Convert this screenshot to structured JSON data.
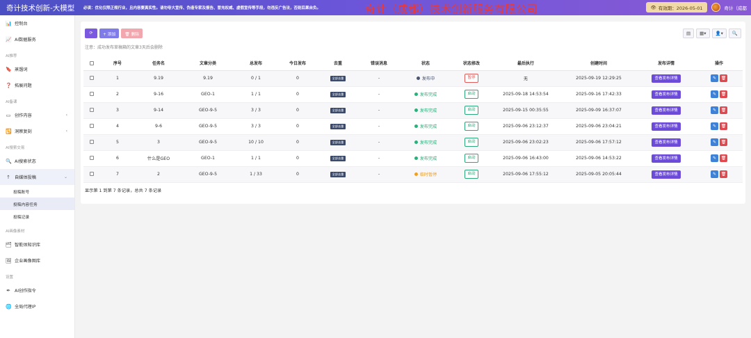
{
  "header": {
    "brand": "奇计技术创新-大模型",
    "notice": "必读：优化仅限正规行业，且内容要真实性。请勿夸大宣传、伪造专家及报告、冒充权威、虚假宣传等手段，勿违反广告法，否则后果自负。",
    "company_banner": "奇计（成都）技术创新服务有限公司",
    "expire_label": "有效期：2026-05-01",
    "username": "奇计（成都"
  },
  "sidebar": {
    "items": [
      {
        "type": "item",
        "icon": "📊",
        "label": "控制台"
      },
      {
        "type": "item",
        "icon": "📈",
        "label": "AI数据服务"
      },
      {
        "type": "group",
        "label": "AI推荐"
      },
      {
        "type": "item",
        "icon": "🔖",
        "label": "蒸馏词"
      },
      {
        "type": "item",
        "icon": "❓",
        "label": "拓展问题"
      },
      {
        "type": "group",
        "label": "AI备课"
      },
      {
        "type": "item",
        "icon": "▭",
        "label": "创作内容",
        "chevron": "‹"
      },
      {
        "type": "item",
        "icon": "🔁",
        "label": "洞察复刻",
        "chevron": "‹"
      },
      {
        "type": "group",
        "label": "AI搜索交易"
      },
      {
        "type": "item",
        "icon": "🔍",
        "label": "AI搜索状态"
      },
      {
        "type": "item",
        "icon": "↑",
        "label": "自媒体投稿",
        "chevron": "⌄",
        "active_parent": true
      },
      {
        "type": "sub",
        "label": "投稿账号"
      },
      {
        "type": "sub",
        "label": "投稿内容任务",
        "active": true
      },
      {
        "type": "sub",
        "label": "投稿记录"
      },
      {
        "type": "group",
        "label": "AI画像素材"
      },
      {
        "type": "item",
        "icon": "🗂",
        "label": "智能体知识库"
      },
      {
        "type": "item",
        "icon": "🖼",
        "label": "企业画像图库"
      },
      {
        "type": "group",
        "label": "设置"
      },
      {
        "type": "item",
        "icon": "✒",
        "label": "AI创作指令"
      },
      {
        "type": "item",
        "icon": "🌐",
        "label": "全局代理IP"
      }
    ]
  },
  "toolbar": {
    "refresh_icon": "⟳",
    "add_label": "+ 添加",
    "delete_label": "🗑 删除",
    "view_buttons": [
      "▤",
      "▦▾",
      "👤▾",
      "🔍"
    ]
  },
  "hint": "注意：成功发布草稿箱的文章3天后会删除",
  "table": {
    "columns": [
      "",
      "序号",
      "任务名",
      "文章分类",
      "总发布",
      "今日发布",
      "去重",
      "错误消息",
      "状态",
      "状态修改",
      "最后执行",
      "创建时间",
      "发布详情",
      "操作"
    ],
    "rows": [
      {
        "no": "1",
        "name": "9.19",
        "category": "9.19",
        "total": "0 / 1",
        "today": "0",
        "dedup": "全部去重",
        "error": "-",
        "status": "发布中",
        "status_color": "#4a5570",
        "action": "暂停",
        "action_kind": "pause",
        "last": "无",
        "created": "2025-09-19 12:29:25",
        "detail": "查看发布详情"
      },
      {
        "no": "2",
        "name": "9-16",
        "category": "GEO-1",
        "total": "1 / 1",
        "today": "0",
        "dedup": "全部去重",
        "error": "-",
        "status": "发布完成",
        "status_color": "#2ab07a",
        "action": "启动",
        "action_kind": "start",
        "last": "2025-09-18 14:53:54",
        "created": "2025-09-16 17:42:33",
        "detail": "查看发布详情"
      },
      {
        "no": "3",
        "name": "9-14",
        "category": "GEO-9-5",
        "total": "3 / 3",
        "today": "0",
        "dedup": "全部去重",
        "error": "-",
        "status": "发布完成",
        "status_color": "#2ab07a",
        "action": "启动",
        "action_kind": "start",
        "last": "2025-09-15 00:35:55",
        "created": "2025-09-09 16:37:07",
        "detail": "查看发布详情"
      },
      {
        "no": "4",
        "name": "9-6",
        "category": "GEO-9-5",
        "total": "3 / 3",
        "today": "0",
        "dedup": "全部去重",
        "error": "-",
        "status": "发布完成",
        "status_color": "#2ab07a",
        "action": "启动",
        "action_kind": "start",
        "last": "2025-09-06 23:12:37",
        "created": "2025-09-06 23:04:21",
        "detail": "查看发布详情"
      },
      {
        "no": "5",
        "name": "3",
        "category": "GEO-9-5",
        "total": "10 / 10",
        "today": "0",
        "dedup": "全部去重",
        "error": "-",
        "status": "发布完成",
        "status_color": "#2ab07a",
        "action": "启动",
        "action_kind": "start",
        "last": "2025-09-06 23:02:23",
        "created": "2025-09-06 17:57:12",
        "detail": "查看发布详情"
      },
      {
        "no": "6",
        "name": "什么是GEO",
        "category": "GEO-1",
        "total": "1 / 1",
        "today": "0",
        "dedup": "全部去重",
        "error": "-",
        "status": "发布完成",
        "status_color": "#2ab07a",
        "action": "启动",
        "action_kind": "start",
        "last": "2025-09-06 16:43:00",
        "created": "2025-09-06 14:53:22",
        "detail": "查看发布详情"
      },
      {
        "no": "7",
        "name": "2",
        "category": "GEO-9-5",
        "total": "1 / 33",
        "today": "0",
        "dedup": "全部去重",
        "error": "-",
        "status": "临时暂停",
        "status_color": "#f0a020",
        "action": "启动",
        "action_kind": "start",
        "last": "2025-09-06 17:55:12",
        "created": "2025-09-05 20:05:44",
        "detail": "查看发布详情"
      }
    ],
    "edit_icon": "✎",
    "delete_icon": "🗑"
  },
  "pagination_text": "显示第 1 到第 7 条记录，总共 7 条记录",
  "colors": {
    "accent": "#6c4bd9",
    "success": "#2ab07a",
    "danger": "#e0474e",
    "warning": "#f0a020"
  }
}
